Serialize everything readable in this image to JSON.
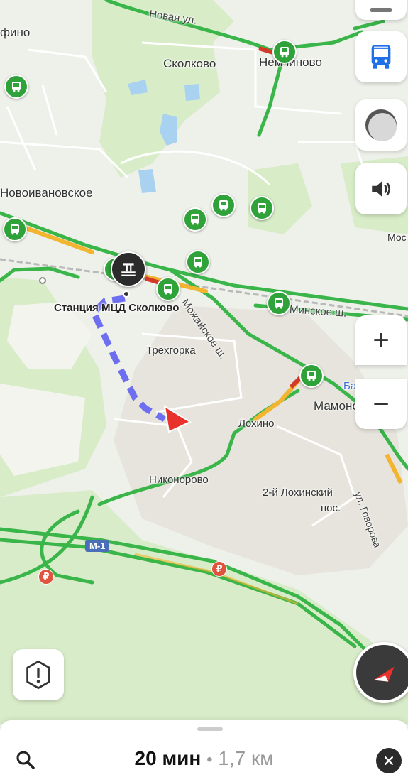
{
  "map": {
    "labels": {
      "fino": "фино",
      "novaya": "Новая ул.",
      "skolkovo": "Сколково",
      "nemchinovo": "Немчиново",
      "novoivanovskoe": "Новоивановское",
      "mos": "Мос",
      "station": "Станция МЦД Сколково",
      "mozhaiskoe": "Можайское ш.",
      "minskoe": "Минское ш.",
      "trekhgorka": "Трёхгорка",
      "bakovka": "Баковка",
      "mamonovo": "Мамоново",
      "lokhino": "Лохино",
      "nikonorovo": "Никонорово",
      "lokhinsky": "2-й Лохинский",
      "pos": "пос.",
      "govorova": "ул. Говорова",
      "m1": "М-1",
      "rouble1": "₽",
      "rouble2": "₽"
    },
    "colors": {
      "route": "#6e6ef0",
      "traffic_green": "#3ab54a",
      "traffic_yellow": "#f3b52f",
      "traffic_red": "#d43a2a",
      "bus_pin": "#2fa33a",
      "location_arrow": "#e8322b"
    },
    "icons": [
      "bus-stop-icon",
      "train-station-icon",
      "location-arrow-icon"
    ]
  },
  "controls": {
    "transport_icon": "bus-icon",
    "layers_icon": "layers-icon",
    "sound_icon": "speaker-icon",
    "zoom_in": "+",
    "zoom_out": "−",
    "report_icon": "exclamation-shield-icon",
    "compass_icon": "compass-icon"
  },
  "route_summary": {
    "time": "20 мин",
    "separator": "•",
    "distance": "1,7 км"
  }
}
